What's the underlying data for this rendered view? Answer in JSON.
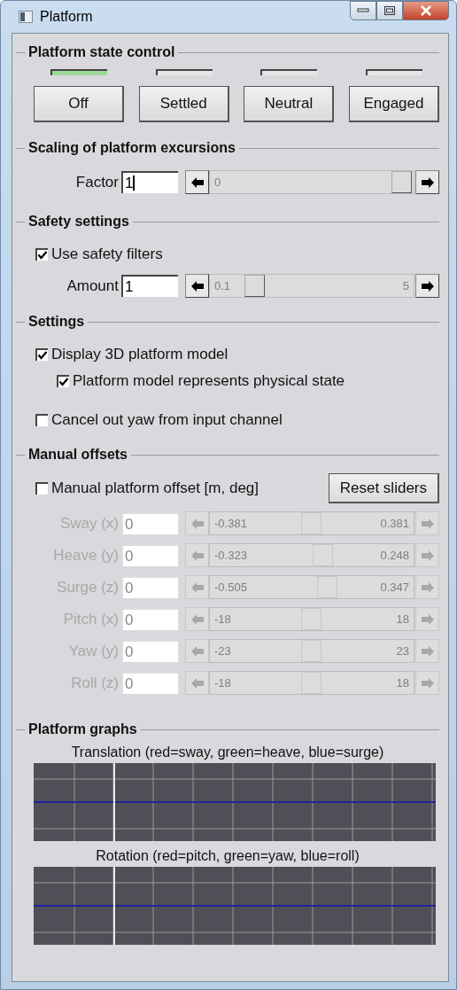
{
  "window": {
    "title": "Platform"
  },
  "state_control": {
    "title": "Platform state control",
    "states": [
      {
        "label": "Off",
        "active": true
      },
      {
        "label": "Settled",
        "active": false
      },
      {
        "label": "Neutral",
        "active": false
      },
      {
        "label": "Engaged",
        "active": false
      }
    ]
  },
  "scaling": {
    "title": "Scaling of platform excursions",
    "factor": {
      "label": "Factor",
      "value": "1",
      "min": "0",
      "level": 1
    }
  },
  "safety": {
    "title": "Safety settings",
    "use_filters": {
      "label": "Use safety filters",
      "checked": true
    },
    "amount": {
      "label": "Amount",
      "value": "1",
      "min": "0.1",
      "max": "5",
      "level": 0.19
    }
  },
  "settings": {
    "title": "Settings",
    "options": [
      {
        "label": "Display 3D platform model",
        "checked": true,
        "children": [
          {
            "label": "Platform model represents physical state",
            "checked": true
          }
        ]
      },
      {
        "label": "Cancel out yaw from input channel",
        "checked": false
      }
    ]
  },
  "manual_offsets": {
    "title": "Manual offsets",
    "enable": {
      "label": "Manual platform offset [m, deg]",
      "checked": false
    },
    "reset_button": "Reset sliders",
    "axes": [
      {
        "label": "Sway (x)",
        "value": "0",
        "min": "-0.381",
        "max": "0.381",
        "level": 0.5,
        "disabled": true
      },
      {
        "label": "Heave (y)",
        "value": "0",
        "min": "-0.323",
        "max": "0.248",
        "level": 0.565,
        "disabled": true
      },
      {
        "label": "Surge (z)",
        "value": "0",
        "min": "-0.505",
        "max": "0.347",
        "level": 0.59,
        "disabled": true
      },
      {
        "label": "Pitch (x)",
        "value": "0",
        "min": "-18",
        "max": "18",
        "level": 0.5,
        "disabled": true
      },
      {
        "label": "Yaw (y)",
        "value": "0",
        "min": "-23",
        "max": "23",
        "level": 0.5,
        "disabled": true
      },
      {
        "label": "Roll (z)",
        "value": "0",
        "min": "-18",
        "max": "18",
        "level": 0.5,
        "disabled": true
      }
    ]
  },
  "graphs": {
    "title": "Platform graphs",
    "plots": [
      {
        "caption": "Translation (red=sway, green=heave, blue=surge)"
      },
      {
        "caption": "Rotation (red=pitch, green=yaw, blue=roll)"
      }
    ]
  }
}
